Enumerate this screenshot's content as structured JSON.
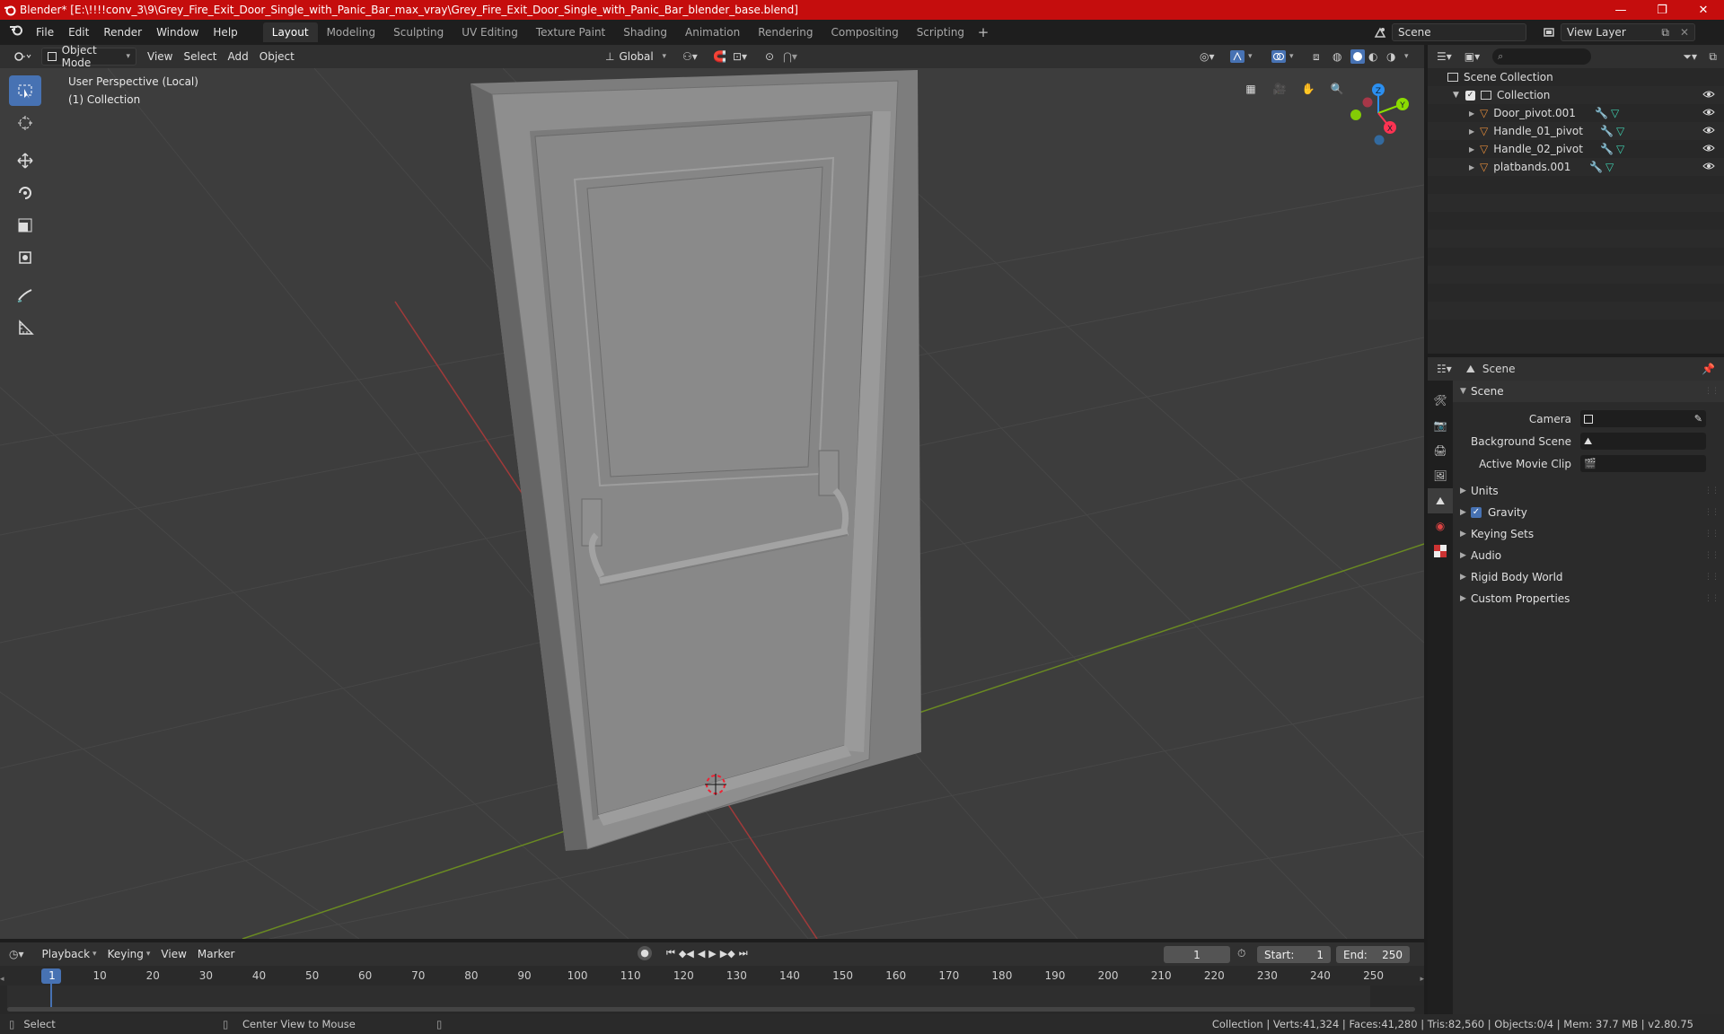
{
  "window": {
    "title": "Blender* [E:\\!!!!conv_3\\9\\Grey_Fire_Exit_Door_Single_with_Panic_Bar_max_vray\\Grey_Fire_Exit_Door_Single_with_Panic_Bar_blender_base.blend]",
    "minimize": "—",
    "maximize": "❐",
    "close": "✕"
  },
  "menu": [
    "File",
    "Edit",
    "Render",
    "Window",
    "Help"
  ],
  "workspaces": [
    "Layout",
    "Modeling",
    "Sculpting",
    "UV Editing",
    "Texture Paint",
    "Shading",
    "Animation",
    "Rendering",
    "Compositing",
    "Scripting"
  ],
  "active_workspace": "Layout",
  "scene_selector": {
    "value": "Scene"
  },
  "view_layer_selector": {
    "value": "View Layer"
  },
  "viewport_header": {
    "mode": "Object Mode",
    "menus": [
      "View",
      "Select",
      "Add",
      "Object"
    ],
    "transform_orientation": "Global"
  },
  "viewport": {
    "perspective_label": "User Perspective (Local)",
    "collection_label": "(1) Collection",
    "axis_colors": {
      "x": "#ff3352",
      "y": "#8bdc00",
      "z": "#2b8ff0"
    },
    "gizmo_labels": {
      "x": "X",
      "y": "Y",
      "z": "Z"
    }
  },
  "outliner": {
    "root": "Scene Collection",
    "collection": "Collection",
    "items": [
      "Door_pivot.001",
      "Handle_01_pivot",
      "Handle_02_pivot",
      "platbands.001"
    ]
  },
  "properties": {
    "context": "Scene",
    "panel_title": "Scene",
    "fields": [
      {
        "label": "Camera"
      },
      {
        "label": "Background Scene"
      },
      {
        "label": "Active Movie Clip"
      }
    ],
    "subpanels": [
      {
        "label": "Units",
        "checkbox": false
      },
      {
        "label": "Gravity",
        "checkbox": true,
        "checked": true
      },
      {
        "label": "Keying Sets",
        "checkbox": false
      },
      {
        "label": "Audio",
        "checkbox": false
      },
      {
        "label": "Rigid Body World",
        "checkbox": false
      },
      {
        "label": "Custom Properties",
        "checkbox": false
      }
    ]
  },
  "timeline": {
    "menus": [
      "Playback",
      "Keying",
      "View",
      "Marker"
    ],
    "current_frame": "1",
    "start_label": "Start:",
    "start": "1",
    "end_label": "End:",
    "end": "250",
    "ruler": [
      "1",
      "10",
      "20",
      "30",
      "40",
      "50",
      "60",
      "70",
      "80",
      "90",
      "100",
      "110",
      "120",
      "130",
      "140",
      "150",
      "160",
      "170",
      "180",
      "190",
      "200",
      "210",
      "220",
      "230",
      "240",
      "250"
    ]
  },
  "statusbar": {
    "left_action": "Select",
    "middle_action": "Center View to Mouse",
    "stats": "Collection | Verts:41,324 | Faces:41,280 | Tris:82,560 | Objects:0/4 | Mem: 37.7 MB | v2.80.75"
  }
}
